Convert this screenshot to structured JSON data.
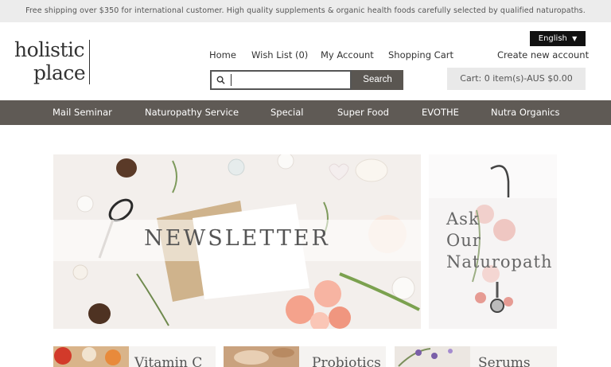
{
  "topbar": {
    "text": "Free shipping over $350 for international customer. High quality supplements & organic health foods carefully selected by qualified naturopaths."
  },
  "logo": {
    "line1": "holistic",
    "line2": "place"
  },
  "language": {
    "label": "English",
    "arrow": "▼"
  },
  "header_links": {
    "home": "Home",
    "wishlist": "Wish List (0)",
    "account": "My Account",
    "cart": "Shopping Cart",
    "create": "Create new account"
  },
  "search": {
    "placeholder": "",
    "button": "Search"
  },
  "cart_summary": "Cart: 0 item(s)-AUS $0.00",
  "main_nav": [
    "Mail Seminar",
    "Naturopathy Service",
    "Special",
    "Super Food",
    "EVOTHE",
    "Nutra Organics"
  ],
  "banner": {
    "title": "NEWSLETTER"
  },
  "ask": {
    "line1": "Ask",
    "line2": "Our",
    "line3": "Naturopath"
  },
  "cards": [
    {
      "label": "Vitamin C"
    },
    {
      "label": "Probiotics"
    },
    {
      "label": "Serums"
    }
  ],
  "colors": {
    "nav_bg": "#5f5a55",
    "search_btn": "#5a5651",
    "topbar_bg": "#ececec",
    "cart_bg": "#e9e9e9"
  }
}
